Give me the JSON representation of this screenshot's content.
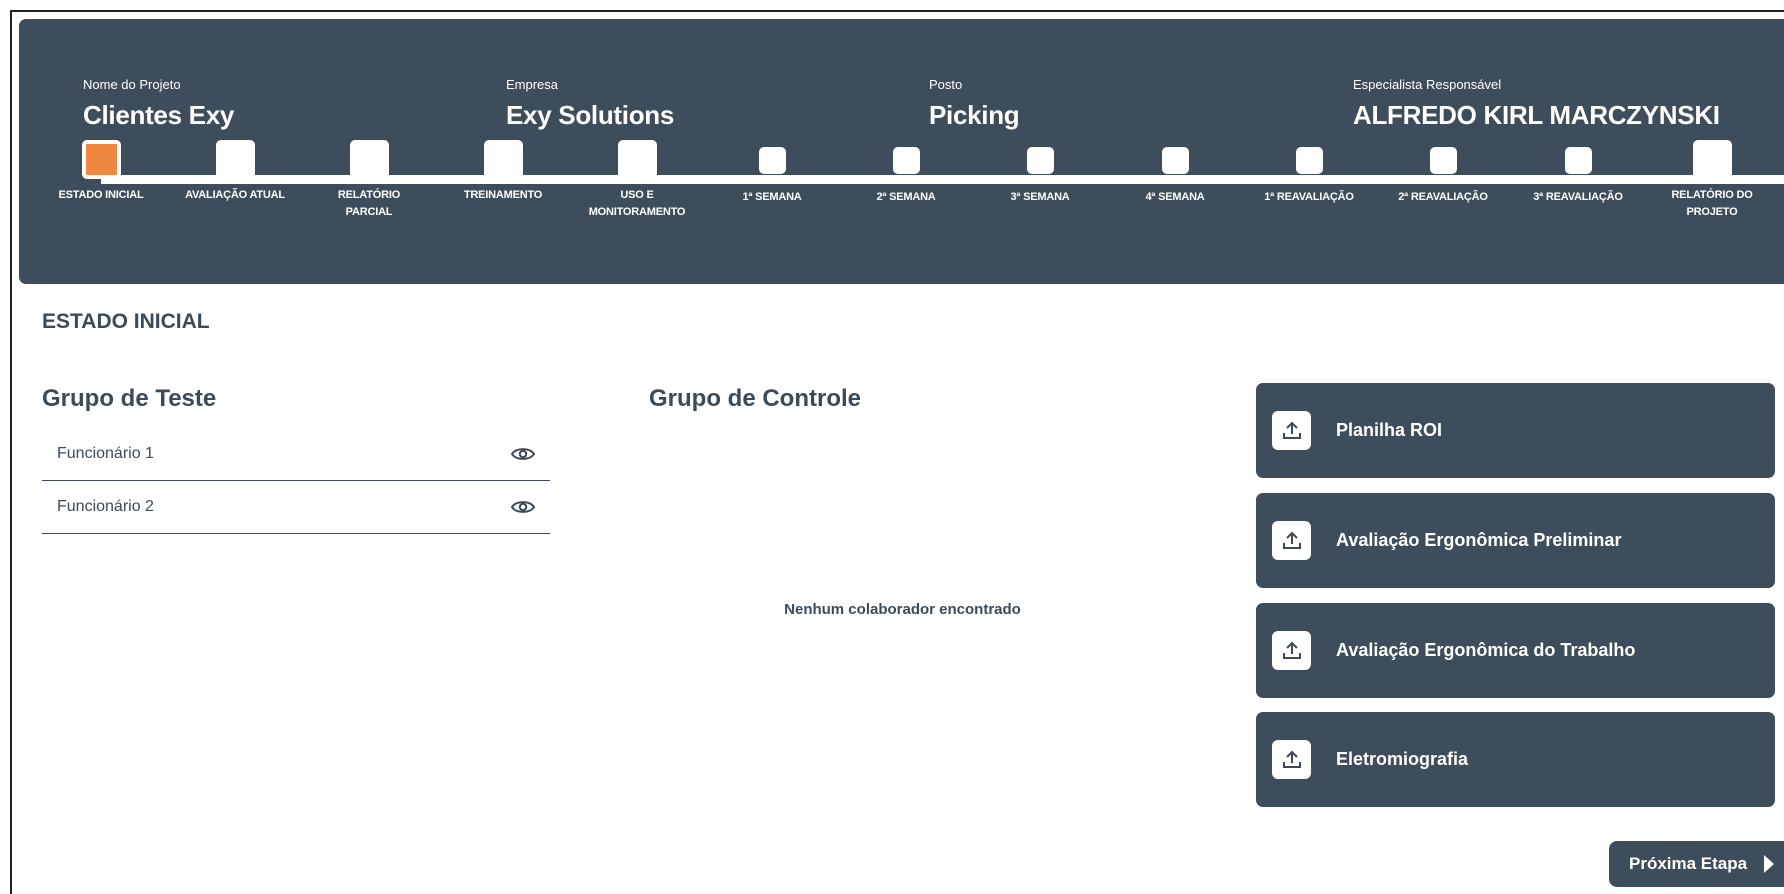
{
  "project": {
    "name_label": "Nome do Projeto",
    "name": "Clientes Exy",
    "company_label": "Empresa",
    "company": "Exy Solutions",
    "post_label": "Posto",
    "post": "Picking",
    "specialist_label": "Especialista Responsável",
    "specialist": "ALFREDO KIRL MARCZYNSKI"
  },
  "steps": [
    {
      "l1": "ESTADO INICIAL",
      "l2": ""
    },
    {
      "l1": "AVALIAÇÃO ATUAL",
      "l2": ""
    },
    {
      "l1": "RELATÓRIO",
      "l2": "PARCIAL"
    },
    {
      "l1": "TREINAMENTO",
      "l2": ""
    },
    {
      "l1": "USO E",
      "l2": "MONITORAMENTO"
    },
    {
      "l1": "1ª SEMANA",
      "l2": ""
    },
    {
      "l1": "2ª SEMANA",
      "l2": ""
    },
    {
      "l1": "3ª SEMANA",
      "l2": ""
    },
    {
      "l1": "4ª SEMANA",
      "l2": ""
    },
    {
      "l1": "1ª REAVALIAÇÃO",
      "l2": ""
    },
    {
      "l1": "2ª REAVALIAÇÃO",
      "l2": ""
    },
    {
      "l1": "3ª REAVALIAÇÃO",
      "l2": ""
    },
    {
      "l1": "RELATÓRIO DO",
      "l2": "PROJETO"
    }
  ],
  "current_step_title": "ESTADO INICIAL",
  "test_group": {
    "title": "Grupo de Teste",
    "employees": [
      "Funcionário 1",
      "Funcionário 2"
    ]
  },
  "control_group": {
    "title": "Grupo de Controle",
    "empty_message": "Nenhum colaborador encontrado"
  },
  "uploads": [
    "Planilha ROI",
    "Avaliação Ergonômica Preliminar",
    "Avaliação Ergonômica do Trabalho",
    "Eletromiografia"
  ],
  "next_button": "Próxima Etapa",
  "icons": {
    "upload": "upload-icon",
    "view": "eye-icon",
    "next": "play-arrow-icon"
  },
  "colors": {
    "header_bg": "#3e4d5b",
    "active_step": "#f08740",
    "text": "#3d4a57"
  }
}
